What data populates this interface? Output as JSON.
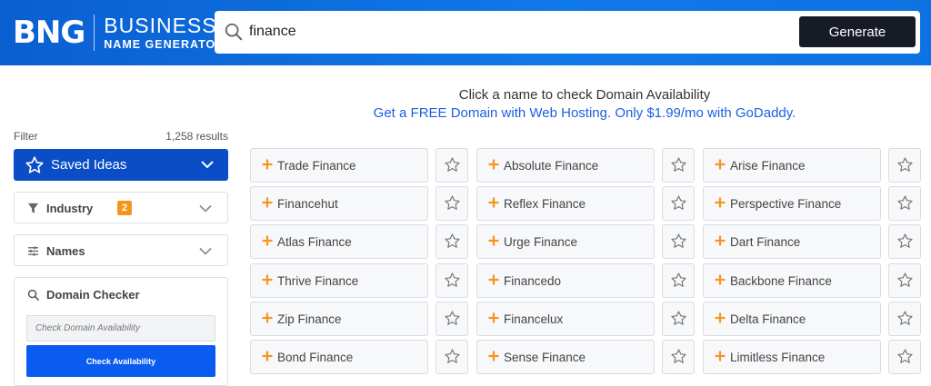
{
  "header": {
    "logo_mark": "BNG",
    "logo_line1": "BUSINESS",
    "logo_line2": "NAME GENERATOR",
    "search_value": "finance",
    "generate_label": "Generate"
  },
  "messages": {
    "click_hint": "Click a name to check Domain Availability",
    "promo": "Get a FREE Domain with Web Hosting. Only $1.99/mo with GoDaddy."
  },
  "sidebar": {
    "filter_label": "Filter",
    "results": "1,258 results",
    "saved_ideas": "Saved Ideas",
    "industry_label": "Industry",
    "industry_badge": "2",
    "names_label": "Names",
    "domain_checker_label": "Domain Checker",
    "domain_placeholder": "Check Domain Availability",
    "check_button": "Check Availability"
  },
  "names": [
    [
      "Trade Finance",
      "Absolute Finance",
      "Arise Finance"
    ],
    [
      "Financehut",
      "Reflex Finance",
      "Perspective Finance"
    ],
    [
      "Atlas Finance",
      "Urge Finance",
      "Dart Finance"
    ],
    [
      "Thrive Finance",
      "Financedo",
      "Backbone Finance"
    ],
    [
      "Zip Finance",
      "Financelux",
      "Delta Finance"
    ],
    [
      "Bond Finance",
      "Sense Finance",
      "Limitless Finance"
    ]
  ],
  "colors": {
    "header_blue": "#0b6fe0",
    "saved_blue": "#0a4dc7",
    "accent_orange": "#f7941d",
    "generate_dark": "#161b26",
    "promo_link": "#1d5fe0"
  }
}
